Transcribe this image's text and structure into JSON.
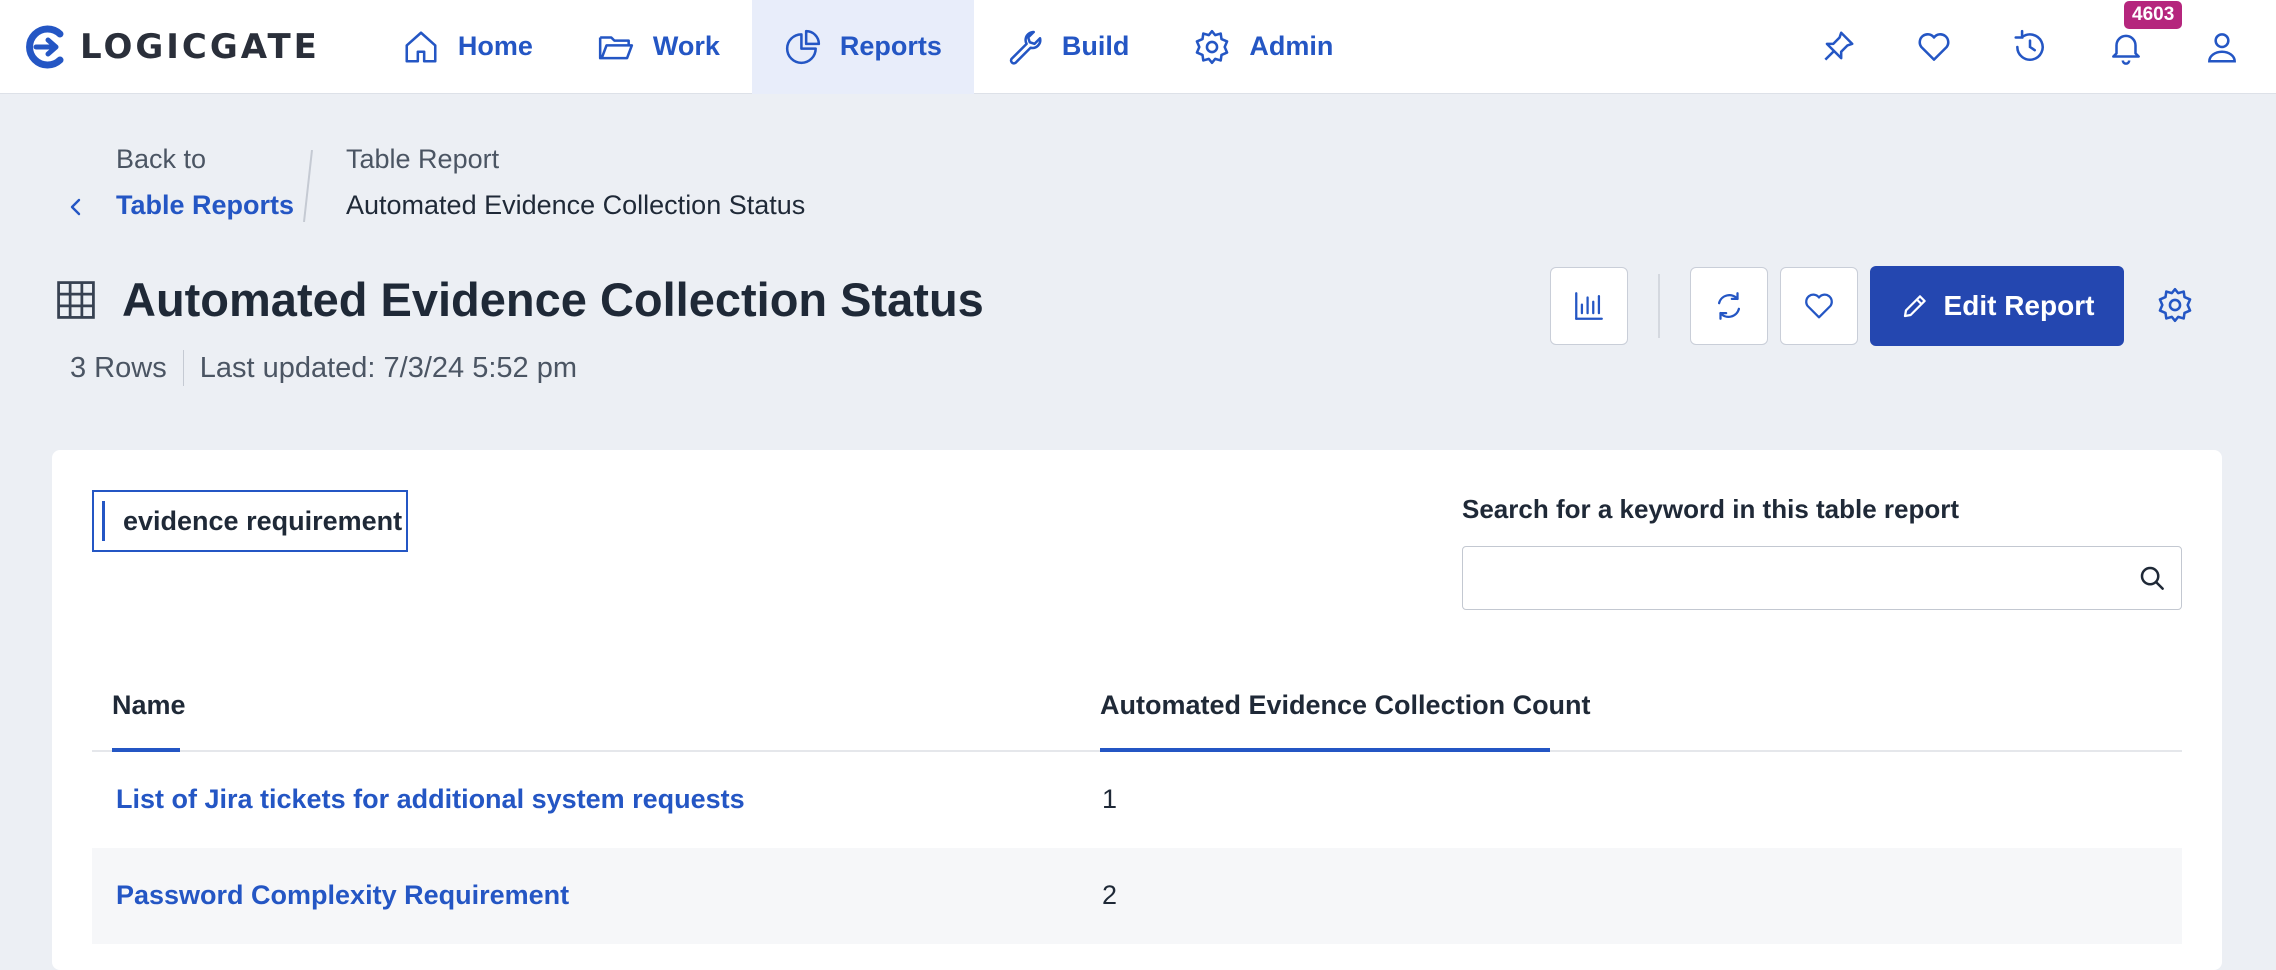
{
  "app": {
    "brand": "LOGICGATE"
  },
  "nav": {
    "items": [
      {
        "label": "Home",
        "icon": "home-icon"
      },
      {
        "label": "Work",
        "icon": "folder-icon"
      },
      {
        "label": "Reports",
        "icon": "pie-chart-icon",
        "active": true
      },
      {
        "label": "Build",
        "icon": "wrench-icon"
      },
      {
        "label": "Admin",
        "icon": "gear-icon"
      }
    ],
    "notification_count": "4603"
  },
  "breadcrumb": {
    "back_prefix": "Back to",
    "back_link": "Table Reports",
    "type": "Table Report",
    "current": "Automated Evidence Collection Status"
  },
  "page": {
    "title": "Automated Evidence Collection Status",
    "rows": "3 Rows",
    "last_updated": "Last updated: 7/3/24 5:52 pm"
  },
  "toolbar": {
    "edit_label": "Edit Report"
  },
  "filter": {
    "chip_label": "evidence requirement"
  },
  "search": {
    "label": "Search for a keyword in this table report",
    "value": "",
    "placeholder": ""
  },
  "table": {
    "headers": [
      "Name",
      "Automated Evidence Collection Count"
    ],
    "rows": [
      {
        "name": "List of Jira tickets for additional system requests",
        "count": "1"
      },
      {
        "name": "Password Complexity Requirement",
        "count": "2"
      }
    ]
  },
  "colors": {
    "accent": "#2456c4",
    "primary_button": "#2447b0",
    "badge": "#b5267d",
    "background": "#eceff4"
  }
}
